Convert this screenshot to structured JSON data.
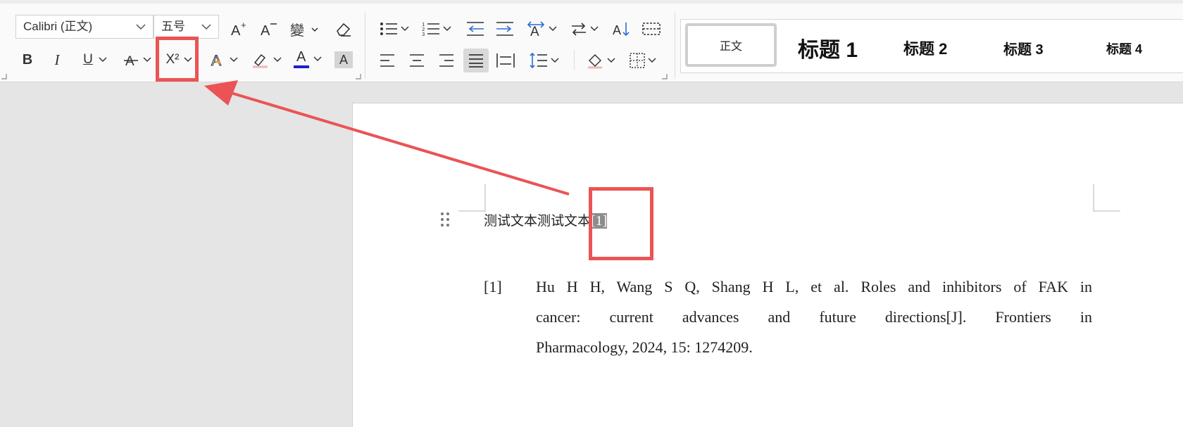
{
  "toolbar": {
    "font_name": "Calibri (正文)",
    "font_size": "五号",
    "bold_label": "B",
    "italic_label": "I",
    "underline_label": "U",
    "superscript_label": "X²",
    "highlight_label": "A",
    "font_color_label": "A",
    "char_shading_label": "A",
    "font_color": "#1f1fd1"
  },
  "styles": [
    {
      "label": "正文"
    },
    {
      "label": "标题 1"
    },
    {
      "label": "标题 2"
    },
    {
      "label": "标题 3"
    },
    {
      "label": "标题 4"
    }
  ],
  "document": {
    "line1_text": "测试文本测试文本",
    "citation_marker": "[1]",
    "reference": {
      "number": "[1]",
      "lines": [
        "Hu H H, Wang S Q, Shang H L, et al. Roles and inhibitors of FAK in",
        "cancer: current advances and future directions[J]. Frontiers in",
        "Pharmacology, 2024, 15: 1274209."
      ]
    }
  },
  "annotation": {
    "color": "#ea5455"
  }
}
